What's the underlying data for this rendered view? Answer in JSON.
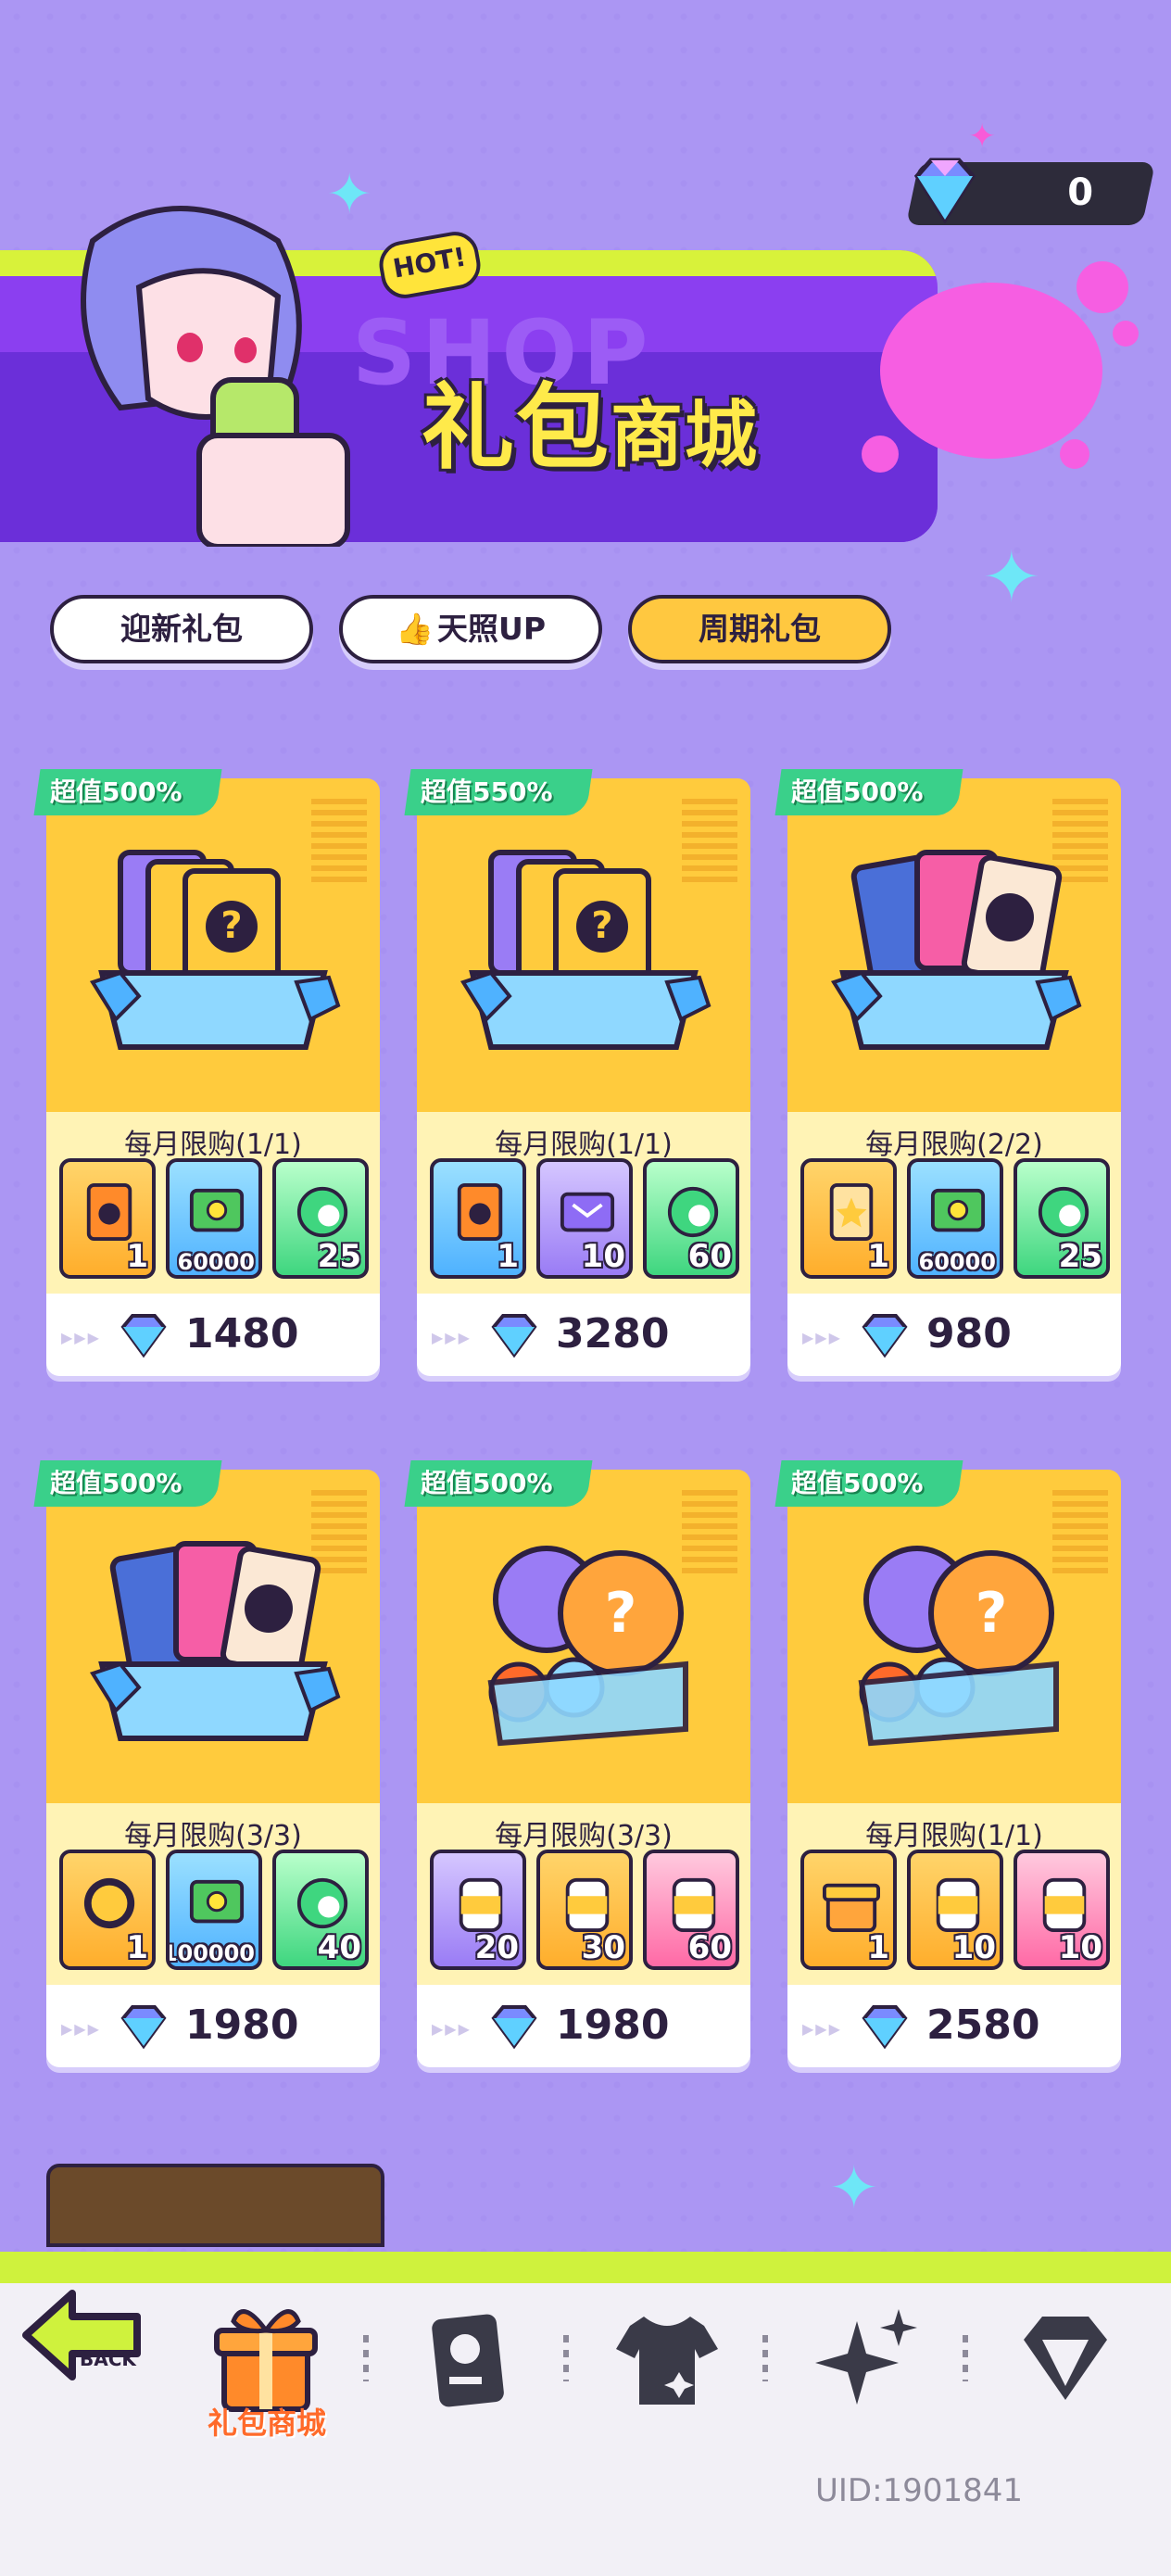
{
  "currency": {
    "value": "0",
    "icon": "diamond-icon"
  },
  "banner": {
    "hot_label": "HOT!",
    "title_big": "礼包",
    "title_small": "商城",
    "watermark": "SHOP"
  },
  "tabs": [
    {
      "label": "迎新礼包",
      "active": false
    },
    {
      "label": "天照UP",
      "active": false,
      "icon": "thumbs-up-icon"
    },
    {
      "label": "周期礼包",
      "active": true
    }
  ],
  "packs": [
    {
      "badge": "超值500%",
      "limit": "每月限购(1/1)",
      "price": "1480",
      "art": "card-box-question",
      "items": [
        {
          "icon": "card-pack-icon",
          "qty": "1",
          "color": "orange"
        },
        {
          "icon": "cash-icon",
          "qty": "60000",
          "color": "blue"
        },
        {
          "icon": "green-token-icon",
          "qty": "25",
          "color": "green"
        }
      ]
    },
    {
      "badge": "超值550%",
      "limit": "每月限购(1/1)",
      "price": "3280",
      "art": "card-box-question",
      "items": [
        {
          "icon": "card-pack-icon",
          "qty": "1",
          "color": "blue"
        },
        {
          "icon": "ticket-icon",
          "qty": "10",
          "color": "purple"
        },
        {
          "icon": "green-token-icon",
          "qty": "60",
          "color": "green"
        }
      ]
    },
    {
      "badge": "超值500%",
      "limit": "每月限购(2/2)",
      "price": "980",
      "art": "card-box-characters",
      "items": [
        {
          "icon": "star-card-icon",
          "qty": "1",
          "color": "orange"
        },
        {
          "icon": "cash-icon",
          "qty": "60000",
          "color": "blue"
        },
        {
          "icon": "green-token-icon",
          "qty": "25",
          "color": "green"
        }
      ]
    },
    {
      "badge": "超值500%",
      "limit": "每月限购(3/3)",
      "price": "1980",
      "art": "card-box-characters",
      "items": [
        {
          "icon": "gold-coin-icon",
          "qty": "1",
          "color": "orange"
        },
        {
          "icon": "cash-icon",
          "qty": "100000",
          "color": "blue"
        },
        {
          "icon": "green-token-icon",
          "qty": "40",
          "color": "green"
        }
      ]
    },
    {
      "badge": "超值500%",
      "limit": "每月限购(3/3)",
      "price": "1980",
      "art": "capsule-box",
      "items": [
        {
          "icon": "can-icon",
          "qty": "20",
          "color": "purple"
        },
        {
          "icon": "can-icon",
          "qty": "30",
          "color": "orange"
        },
        {
          "icon": "can-icon",
          "qty": "60",
          "color": "pink"
        }
      ]
    },
    {
      "badge": "超值500%",
      "limit": "每月限购(1/1)",
      "price": "2580",
      "art": "capsule-box",
      "items": [
        {
          "icon": "gift-box-icon",
          "qty": "1",
          "color": "orange"
        },
        {
          "icon": "can-icon",
          "qty": "10",
          "color": "orange"
        },
        {
          "icon": "can-icon",
          "qty": "10",
          "color": "pink"
        }
      ]
    }
  ],
  "nav": {
    "back_label": "BACK",
    "active_label": "礼包商城",
    "items": [
      "gift-icon",
      "card-icon",
      "shirt-icon",
      "sparkle-icon",
      "diamond-icon"
    ]
  },
  "uid": "UID:1901841",
  "colors": {
    "background": "#ab96f3",
    "banner": "#8b3ff0",
    "accent_yellow": "#ffcb3d",
    "badge_green": "#3ad08a",
    "lime": "#cff23d"
  }
}
